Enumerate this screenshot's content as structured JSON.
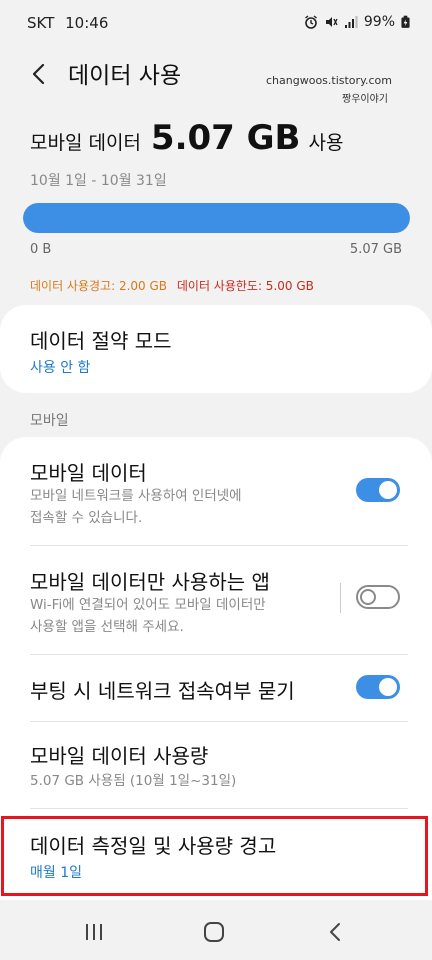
{
  "status_bar": {
    "carrier": "SKT",
    "time": "10:46",
    "battery": "99%",
    "icons": [
      "alarm-icon",
      "mute-icon",
      "signal-icon",
      "battery-icon"
    ]
  },
  "header": {
    "title": "데이터 사용",
    "watermark_line1": "changwoos.tistory.com",
    "watermark_line2": "짱우이야기"
  },
  "summary": {
    "prefix": "모바일 데이터",
    "value": "5.07 GB",
    "suffix": "사용",
    "period": "10월 1일 - 10월 31일",
    "bar_min": "0 B",
    "bar_max": "5.07 GB",
    "usage_fraction": 1.0,
    "warning": "데이터 사용경고: 2.00 GB",
    "limit": "데이터 사용한도: 5.00 GB"
  },
  "data_saver": {
    "title": "데이터 절약 모드",
    "status": "사용 안 함"
  },
  "mobile_section": {
    "label": "모바일",
    "items": [
      {
        "title": "모바일 데이터",
        "subtitle_line1": "모바일 네트워크를 사용하여 인터넷에",
        "subtitle_line2": "접속할 수 있습니다.",
        "toggle": "on"
      },
      {
        "title": "모바일 데이터만 사용하는 앱",
        "subtitle_line1": "Wi-Fi에 연결되어 있어도 모바일 데이터만",
        "subtitle_line2": "사용할 앱을 선택해 주세요.",
        "toggle": "off"
      },
      {
        "title": "부팅 시 네트워크 접속여부 묻기",
        "toggle": "on"
      },
      {
        "title": "모바일 데이터 사용량",
        "subtitle_line1": "5.07 GB 사용됨 (10월 1일~31일)"
      },
      {
        "title": "데이터 측정일 및 사용량 경고",
        "status": "매월 1일"
      }
    ]
  },
  "colors": {
    "accent": "#3d8fe6",
    "link_blue": "#1e7bc8",
    "warning_orange": "#d97a1a",
    "limit_red": "#cc2a1a",
    "highlight_red": "#e8141e"
  }
}
